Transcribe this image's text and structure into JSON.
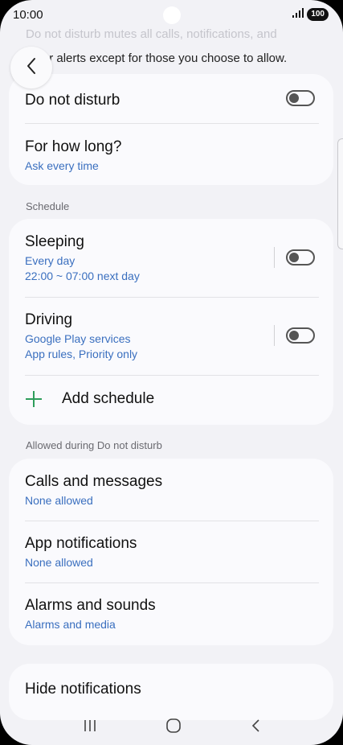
{
  "status_bar": {
    "time": "10:00",
    "battery": "100"
  },
  "intro": {
    "line1": "Do not disturb mutes all calls, notifications, and",
    "line2": "other alerts except for those you choose to allow."
  },
  "main_card": {
    "dnd_label": "Do not disturb",
    "dnd_on": false,
    "duration_label": "For how long?",
    "duration_value": "Ask every time"
  },
  "schedule": {
    "section_label": "Schedule",
    "items": [
      {
        "title": "Sleeping",
        "line1": "Every day",
        "line2": "22:00 ~ 07:00 next day",
        "on": false
      },
      {
        "title": "Driving",
        "line1": "Google Play services",
        "line2": "App rules, Priority only",
        "on": false
      }
    ],
    "add_label": "Add schedule"
  },
  "allowed": {
    "section_label": "Allowed during Do not disturb",
    "items": [
      {
        "title": "Calls and messages",
        "sub": "None allowed"
      },
      {
        "title": "App notifications",
        "sub": "None allowed"
      },
      {
        "title": "Alarms and sounds",
        "sub": "Alarms and media"
      }
    ]
  },
  "hide_notifications": {
    "label": "Hide notifications"
  },
  "colors": {
    "accent": "#3a6fbf",
    "add_plus": "#2e9d5b",
    "background": "#f2f2f6"
  }
}
